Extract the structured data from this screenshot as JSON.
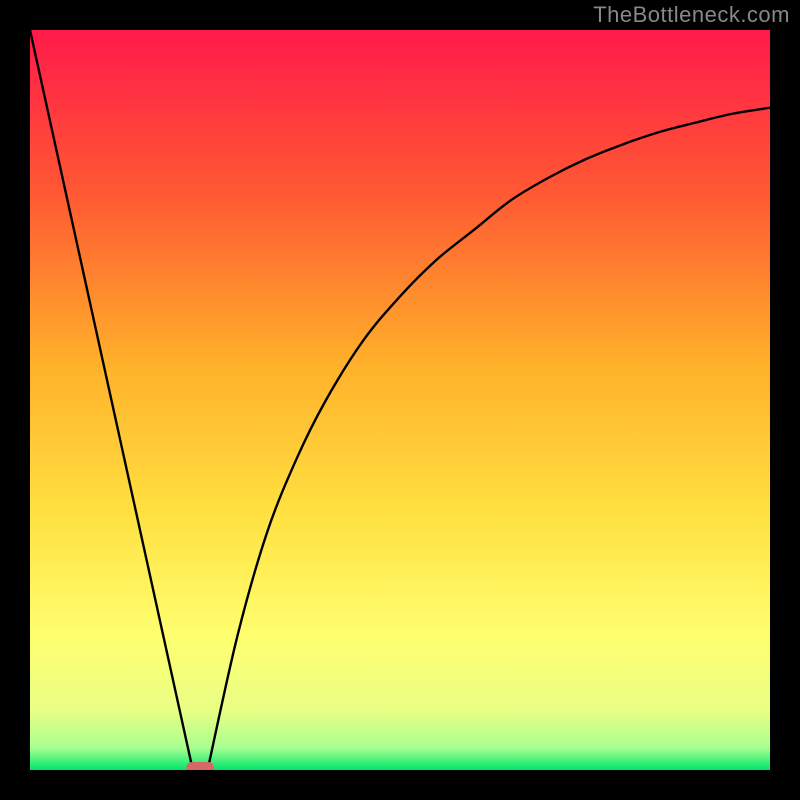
{
  "watermark": "TheBottleneck.com",
  "chart_data": {
    "type": "line",
    "title": "",
    "xlabel": "",
    "ylabel": "",
    "xlim": [
      0,
      100
    ],
    "ylim": [
      0,
      100
    ],
    "grid": false,
    "legend": false,
    "background_gradient": {
      "top": "#ff1a4a",
      "mid_upper": "#ff7a33",
      "mid": "#ffd633",
      "mid_lower": "#ffff66",
      "near_bottom": "#eaff80",
      "bottom": "#00e66b"
    },
    "series": [
      {
        "name": "left-branch",
        "x": [
          0,
          22
        ],
        "y": [
          100,
          0
        ],
        "style": "straight"
      },
      {
        "name": "right-branch",
        "x": [
          24,
          28,
          32,
          36,
          40,
          45,
          50,
          55,
          60,
          65,
          70,
          75,
          80,
          85,
          90,
          95,
          100
        ],
        "y": [
          0,
          18,
          32,
          42,
          50,
          58,
          64,
          69,
          73,
          77,
          80,
          82.5,
          84.5,
          86.2,
          87.5,
          88.7,
          89.5
        ],
        "style": "curve"
      }
    ],
    "marker": {
      "x": 23,
      "y": 0,
      "color": "#d66868",
      "shape": "pill"
    }
  }
}
